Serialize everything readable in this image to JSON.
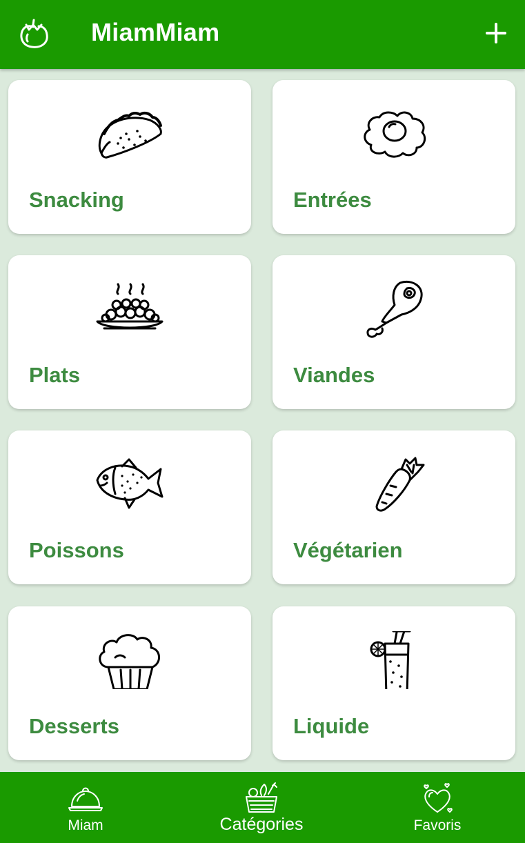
{
  "app": {
    "title": "MiamMiam",
    "accent": "#1a9a00",
    "label_color": "#3d8b40"
  },
  "toolbar": {
    "logo_icon": "tomato-icon",
    "add_icon": "plus-icon"
  },
  "categories": [
    {
      "label": "Snacking",
      "icon": "taco-icon"
    },
    {
      "label": "Entrées",
      "icon": "fried-egg-icon"
    },
    {
      "label": "Plats",
      "icon": "hot-dish-icon"
    },
    {
      "label": "Viandes",
      "icon": "drumstick-icon"
    },
    {
      "label": "Poissons",
      "icon": "fish-icon"
    },
    {
      "label": "Végétarien",
      "icon": "carrot-icon"
    },
    {
      "label": "Desserts",
      "icon": "muffin-icon"
    },
    {
      "label": "Liquide",
      "icon": "cocktail-icon"
    }
  ],
  "bottom_nav": [
    {
      "label": "Miam",
      "icon": "cloche-icon",
      "active": false
    },
    {
      "label": "Catégories",
      "icon": "basket-icon",
      "active": true
    },
    {
      "label": "Favoris",
      "icon": "heart-icon",
      "active": false
    }
  ]
}
